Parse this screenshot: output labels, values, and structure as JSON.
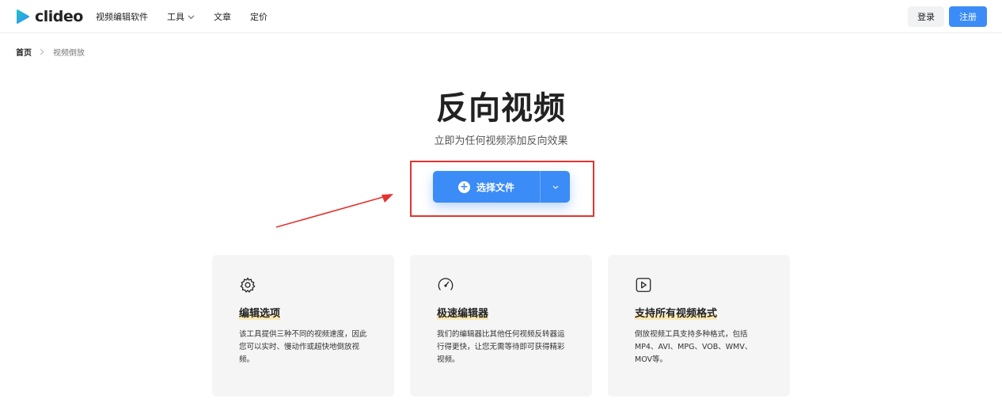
{
  "header": {
    "logo_text": "clideo",
    "nav": {
      "video_editor": "视频编辑软件",
      "tools": "工具",
      "articles": "文章",
      "pricing": "定价"
    },
    "login": "登录",
    "signup": "注册"
  },
  "breadcrumb": {
    "home": "首页",
    "current": "视频倒放"
  },
  "hero": {
    "title": "反向视频",
    "subtitle": "立即为任何视频添加反向效果",
    "upload_label": "选择文件"
  },
  "features": [
    {
      "icon": "gear-icon",
      "title": "编辑选项",
      "desc": "该工具提供三种不同的视频速度，因此您可以实时、慢动作或超快地倒放视频。"
    },
    {
      "icon": "speedometer-icon",
      "title": "极速编辑器",
      "desc": "我们的编辑器比其他任何视频反转器运行得更快，让您无需等待即可获得精彩视频。"
    },
    {
      "icon": "play-icon",
      "title": "支持所有视频格式",
      "desc": "倒放视频工具支持多种格式，包括MP4、AVI、MPG、VOB、WMV、MOV等。"
    }
  ],
  "colors": {
    "accent": "#3b8cf6",
    "annotation_red": "#e3342f",
    "card_bg": "#f5f5f6",
    "title_highlight": "#fce9b3"
  }
}
